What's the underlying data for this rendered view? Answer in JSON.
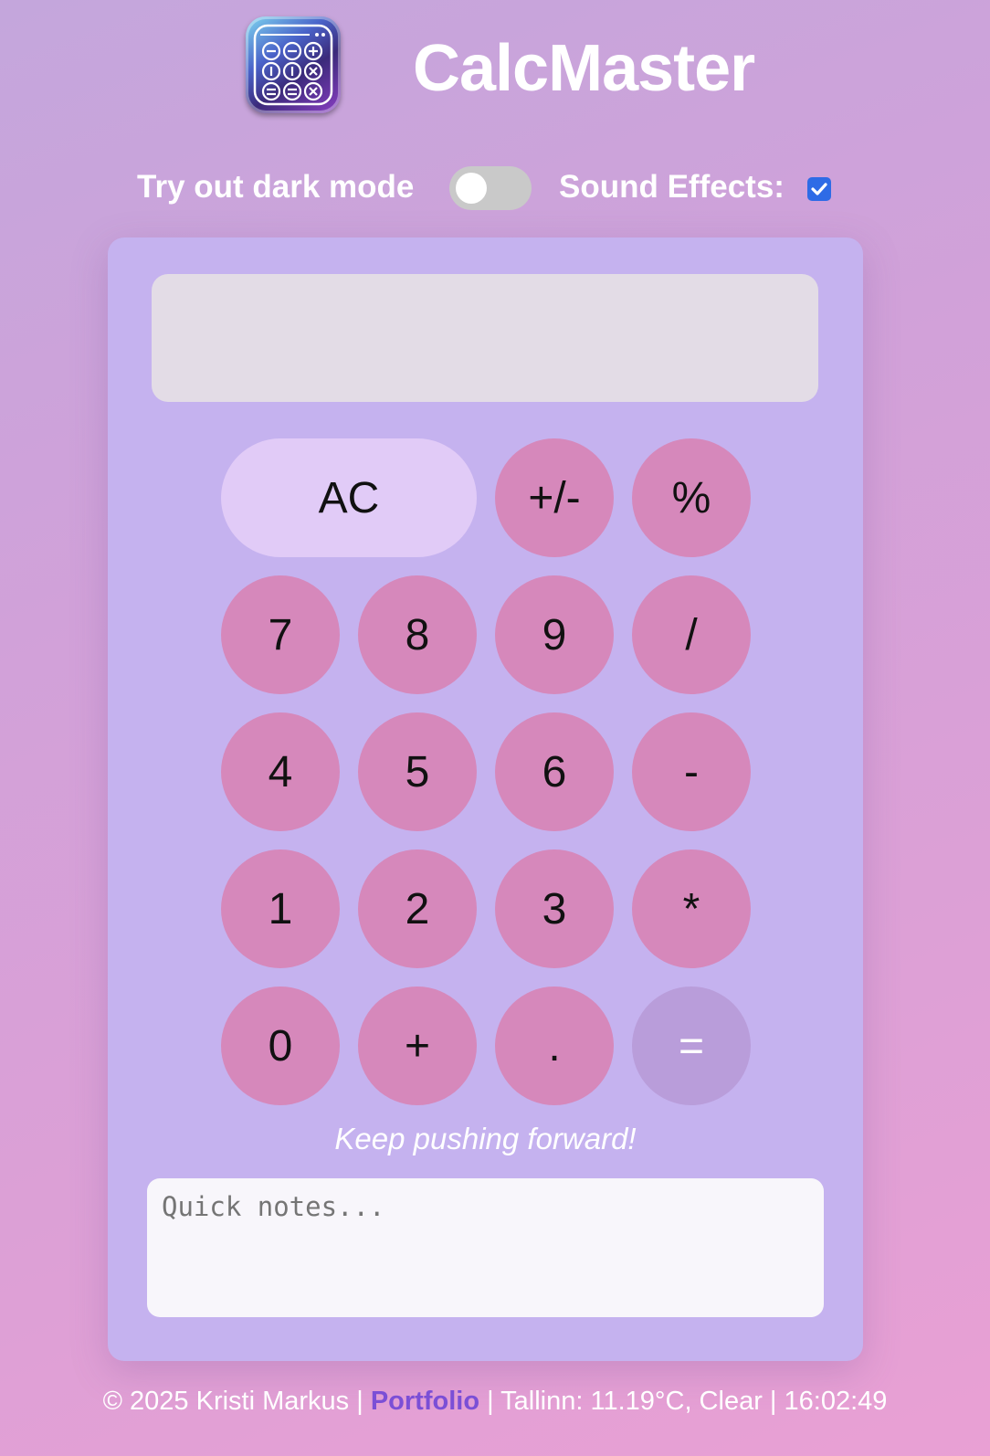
{
  "header": {
    "title": "CalcMaster",
    "icon": "calculator-app-icon"
  },
  "settings": {
    "dark_mode_label": "Try out dark mode",
    "dark_mode_on": false,
    "sound_label": "Sound Effects:",
    "sound_on": true
  },
  "calculator": {
    "display_value": "",
    "buttons": {
      "ac": "AC",
      "plus_minus": "+/-",
      "percent": "%",
      "seven": "7",
      "eight": "8",
      "nine": "9",
      "divide": "/",
      "four": "4",
      "five": "5",
      "six": "6",
      "minus": "-",
      "one": "1",
      "two": "2",
      "three": "3",
      "multiply": "*",
      "zero": "0",
      "plus": "+",
      "dot": ".",
      "equals": "="
    },
    "motivation": "Keep pushing forward!",
    "notes_placeholder": "Quick notes..."
  },
  "footer": {
    "copyright": "© 2025 Kristi Markus | ",
    "portfolio_link": "Portfolio",
    "weather": " | Tallinn: 11.19°C, Clear | 16:02:49"
  },
  "colors": {
    "panel": "#c5b2ef",
    "button": "#d688bb",
    "button_ac": "#e1cbf7",
    "button_equals": "#b99dda",
    "link": "#7b4fd6",
    "checkbox": "#2e6be6"
  }
}
